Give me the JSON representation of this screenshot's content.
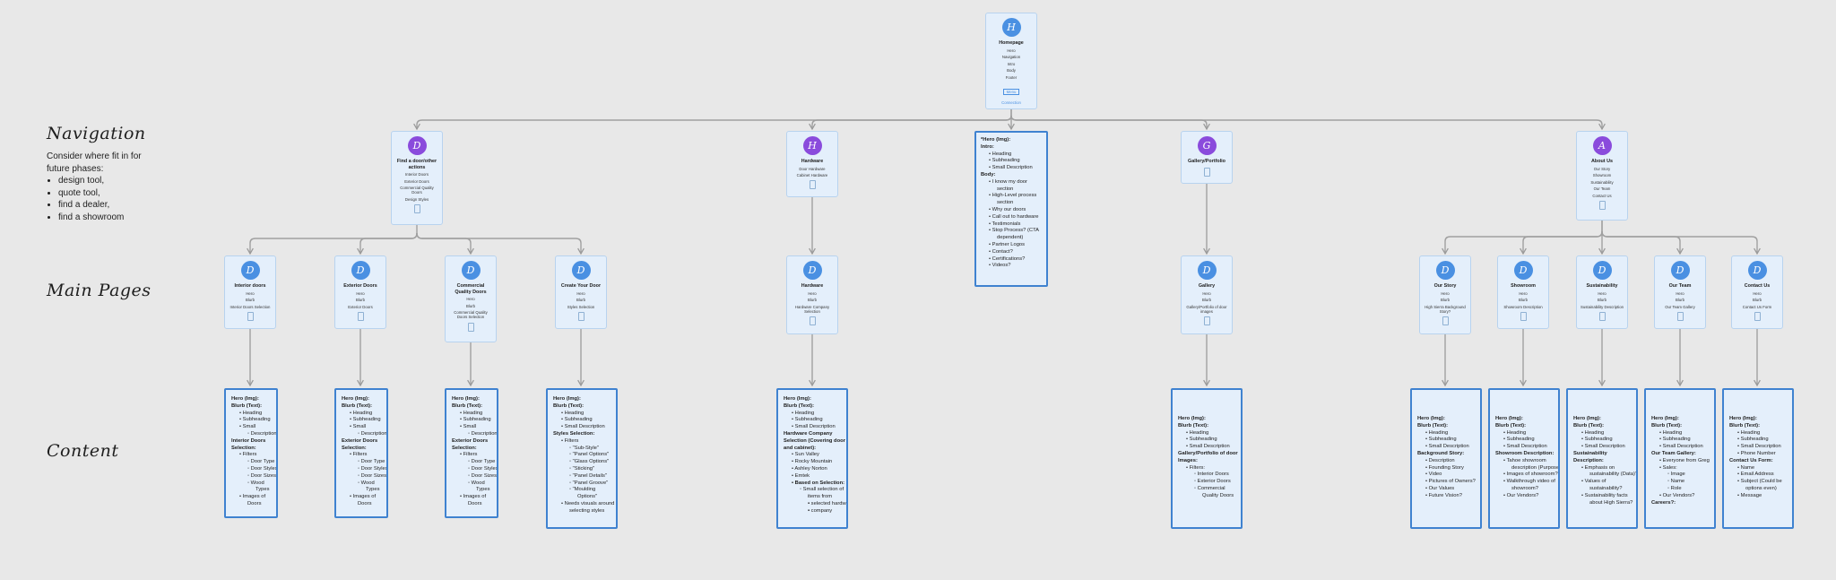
{
  "sections": {
    "navigation": "Navigation",
    "main_pages": "Main Pages",
    "content": "Content"
  },
  "nav_note": {
    "intro": "Consider where fit in for future phases:",
    "items": [
      "design tool,",
      "quote tool,",
      "find a dealer,",
      "find a showroom"
    ]
  },
  "cards": {
    "homepage": {
      "avatar": "H",
      "title": "Homepage",
      "items": [
        "Hero",
        "Navigation",
        "Intro",
        "Body",
        "Footer"
      ],
      "mini": "Menu",
      "link": "Connection"
    },
    "find_door": {
      "avatar": "D",
      "title": "Find a door/other actions",
      "items": [
        "Interior Doors",
        "Exterior Doors",
        "Commercial Quality Doors",
        "Design Styles"
      ]
    },
    "hardware_nav": {
      "avatar": "H",
      "title": "Hardware",
      "items": [
        "Door Hardware",
        "Cabinet Hardware"
      ]
    },
    "gallery_nav": {
      "avatar": "G",
      "title": "Gallery/Portfolio",
      "items": []
    },
    "about_nav": {
      "avatar": "A",
      "title": "About Us",
      "items": [
        "Our Story",
        "Showroom",
        "Sustainability",
        "Our Team",
        "Contact Us"
      ]
    },
    "interior": {
      "avatar": "D",
      "title": "Interior doors",
      "items": [
        "Hero",
        "Blurb",
        "Interior Doors Selection"
      ]
    },
    "exterior": {
      "avatar": "D",
      "title": "Exterior Doors",
      "items": [
        "Hero",
        "Blurb",
        "Exterior Doors"
      ]
    },
    "commercial": {
      "avatar": "D",
      "title": "Commercial Quality Doors",
      "items": [
        "Hero",
        "Blurb",
        "Commercial Quality Doors Selection"
      ]
    },
    "create_door": {
      "avatar": "D",
      "title": "Create Your Door",
      "items": [
        "Hero",
        "Blurb",
        "Styles Selection"
      ]
    },
    "hardware_main": {
      "avatar": "D",
      "title": "Hardware",
      "items": [
        "Hero",
        "Blurb",
        "Hardware Company Selection"
      ]
    },
    "gallery_main": {
      "avatar": "D",
      "title": "Gallery",
      "items": [
        "Hero",
        "Blurb",
        "Gallery/Portfolio of door images"
      ]
    },
    "our_story": {
      "avatar": "D",
      "title": "Our Story",
      "items": [
        "Hero",
        "Blurb",
        "High Sierra Background Story?"
      ]
    },
    "showroom": {
      "avatar": "D",
      "title": "Showroom",
      "items": [
        "Hero",
        "Blurb",
        "Showroom Description"
      ]
    },
    "sustainability": {
      "avatar": "D",
      "title": "Sustainability",
      "items": [
        "Hero",
        "Blurb",
        "Sustainability Description"
      ]
    },
    "our_team": {
      "avatar": "D",
      "title": "Our Team",
      "items": [
        "Hero",
        "Blurb",
        "Our Team Gallery"
      ]
    },
    "contact_us": {
      "avatar": "D",
      "title": "Contact Us",
      "items": [
        "Hero",
        "Blurb",
        "Contact Us Form"
      ]
    }
  },
  "content_boxes": {
    "home_content": [
      {
        "t": "*Hero (Img):",
        "b": true,
        "i": 0
      },
      {
        "t": "Intro:",
        "b": true,
        "i": 0
      },
      {
        "t": "Heading",
        "i": 1
      },
      {
        "t": "Subheading",
        "i": 1
      },
      {
        "t": "Small Description",
        "i": 1
      },
      {
        "t": "Body:",
        "b": true,
        "i": 0
      },
      {
        "t": "I know my door",
        "i": 1
      },
      {
        "t": "section",
        "i": 2
      },
      {
        "t": "High-Level process",
        "i": 1
      },
      {
        "t": "section",
        "i": 2
      },
      {
        "t": "Why our doors",
        "i": 1
      },
      {
        "t": "Call out to hardware",
        "i": 1
      },
      {
        "t": "Testimonials",
        "i": 1
      },
      {
        "t": "Stop Process? (CTA",
        "i": 1
      },
      {
        "t": "dependent)",
        "i": 2
      },
      {
        "t": "Partner Logos",
        "i": 1
      },
      {
        "t": "Contact?",
        "i": 1
      },
      {
        "t": "Certifications?",
        "i": 1
      },
      {
        "t": "Videos?",
        "i": 1
      }
    ],
    "interior_content": [
      {
        "t": "Hero (Img):",
        "b": true,
        "i": 0
      },
      {
        "t": "Blurb (Text):",
        "b": true,
        "i": 0
      },
      {
        "t": "Heading",
        "i": 1
      },
      {
        "t": "Subheading",
        "i": 1
      },
      {
        "t": "Small",
        "i": 1
      },
      {
        "t": "Description",
        "i": 2
      },
      {
        "t": "Interior Doors",
        "b": true,
        "i": 0
      },
      {
        "t": "Selection:",
        "b": true,
        "i": 0
      },
      {
        "t": "Filters",
        "i": 1
      },
      {
        "t": "Door Type",
        "i": 2
      },
      {
        "t": "Door Styles",
        "i": 2
      },
      {
        "t": "Door Sizes",
        "i": 2
      },
      {
        "t": "Wood",
        "i": 2
      },
      {
        "t": "Types",
        "i": 3
      },
      {
        "t": "Images of",
        "i": 1
      },
      {
        "t": "Doors",
        "i": 2
      }
    ],
    "exterior_content": [
      {
        "t": "Hero (Img):",
        "b": true,
        "i": 0
      },
      {
        "t": "Blurb (Text):",
        "b": true,
        "i": 0
      },
      {
        "t": "Heading",
        "i": 1
      },
      {
        "t": "Subheading",
        "i": 1
      },
      {
        "t": "Small",
        "i": 1
      },
      {
        "t": "Description",
        "i": 2
      },
      {
        "t": "Exterior Doors",
        "b": true,
        "i": 0
      },
      {
        "t": "Selection:",
        "b": true,
        "i": 0
      },
      {
        "t": "Filters",
        "i": 1
      },
      {
        "t": "Door Type",
        "i": 2
      },
      {
        "t": "Door Styles",
        "i": 2
      },
      {
        "t": "Door Sizes",
        "i": 2
      },
      {
        "t": "Wood",
        "i": 2
      },
      {
        "t": "Types",
        "i": 3
      },
      {
        "t": "Images of",
        "i": 1
      },
      {
        "t": "Doors",
        "i": 2
      }
    ],
    "commercial_content": [
      {
        "t": "Hero (Img):",
        "b": true,
        "i": 0
      },
      {
        "t": "Blurb (Text):",
        "b": true,
        "i": 0
      },
      {
        "t": "Heading",
        "i": 1
      },
      {
        "t": "Subheading",
        "i": 1
      },
      {
        "t": "Small",
        "i": 1
      },
      {
        "t": "Description",
        "i": 2
      },
      {
        "t": "Exterior Doors",
        "b": true,
        "i": 0
      },
      {
        "t": "Selection:",
        "b": true,
        "i": 0
      },
      {
        "t": "Filters",
        "i": 1
      },
      {
        "t": "Door Type",
        "i": 2
      },
      {
        "t": "Door Styles",
        "i": 2
      },
      {
        "t": "Door Sizes",
        "i": 2
      },
      {
        "t": "Wood",
        "i": 2
      },
      {
        "t": "Types",
        "i": 3
      },
      {
        "t": "Images of",
        "i": 1
      },
      {
        "t": "Doors",
        "i": 2
      }
    ],
    "create_content": [
      {
        "t": "Hero (Img):",
        "b": true,
        "i": 0
      },
      {
        "t": "Blurb (Text):",
        "b": true,
        "i": 0
      },
      {
        "t": "Heading",
        "i": 1
      },
      {
        "t": "Subheading",
        "i": 1
      },
      {
        "t": "Small Description",
        "i": 1
      },
      {
        "t": "Styles Selection:",
        "b": true,
        "i": 0
      },
      {
        "t": "Filters",
        "i": 1
      },
      {
        "t": "\"Sub-Style\"",
        "i": 2
      },
      {
        "t": "\"Panel Options\"",
        "i": 2
      },
      {
        "t": "\"Glass Options\"",
        "i": 2
      },
      {
        "t": "\"Sticking\"",
        "i": 2
      },
      {
        "t": "\"Panel Details\"",
        "i": 2
      },
      {
        "t": "\"Panel Groove\"",
        "i": 2
      },
      {
        "t": "\"Moulding",
        "i": 2
      },
      {
        "t": "Options\"",
        "i": 3
      },
      {
        "t": "Needs visuals around",
        "i": 1
      },
      {
        "t": "selecting styles",
        "i": 2
      }
    ],
    "hardware_content": [
      {
        "t": "Hero (Img):",
        "b": true,
        "i": 0
      },
      {
        "t": "Blurb (Text):",
        "b": true,
        "i": 0
      },
      {
        "t": "Heading",
        "i": 1
      },
      {
        "t": "Subheading",
        "i": 1
      },
      {
        "t": "Small Description",
        "i": 1
      },
      {
        "t": "Hardware Company",
        "b": true,
        "i": 0
      },
      {
        "t": "Selection (Covering door",
        "b": true,
        "i": 0
      },
      {
        "t": "and cabinet):",
        "b": true,
        "i": 0
      },
      {
        "t": "Sun Valley",
        "i": 1
      },
      {
        "t": "Rocky Mountain",
        "i": 1
      },
      {
        "t": "Ashley Norton",
        "i": 1
      },
      {
        "t": "Emtek",
        "i": 1
      },
      {
        "t": "Based on Selection:",
        "b": true,
        "i": 1
      },
      {
        "t": "Small selection of",
        "i": 2
      },
      {
        "t": "items from",
        "i": 3
      },
      {
        "t": "selected hardware",
        "i": 3
      },
      {
        "t": "company",
        "i": 3
      }
    ],
    "gallery_content": [
      {
        "t": "Hero (Img):",
        "b": true,
        "i": 0
      },
      {
        "t": "Blurb (Text):",
        "b": true,
        "i": 0
      },
      {
        "t": "Heading",
        "i": 1
      },
      {
        "t": "Subheading",
        "i": 1
      },
      {
        "t": "Small Description",
        "i": 1
      },
      {
        "t": "Gallery/Portfolio of door",
        "b": true,
        "i": 0
      },
      {
        "t": "Images:",
        "b": true,
        "i": 0
      },
      {
        "t": "Filters:",
        "i": 1
      },
      {
        "t": "Interior Doors",
        "i": 2
      },
      {
        "t": "Exterior Doors",
        "i": 2
      },
      {
        "t": "Commercial",
        "i": 2
      },
      {
        "t": "Quality Doors",
        "i": 3
      }
    ],
    "story_content": [
      {
        "t": "Hero (Img):",
        "b": true,
        "i": 0
      },
      {
        "t": "Blurb (Text):",
        "b": true,
        "i": 0
      },
      {
        "t": "Heading",
        "i": 1
      },
      {
        "t": "Subheading",
        "i": 1
      },
      {
        "t": "Small Description",
        "i": 1
      },
      {
        "t": "Background Story:",
        "b": true,
        "i": 0
      },
      {
        "t": "Description",
        "i": 1
      },
      {
        "t": "Founding Story",
        "i": 1
      },
      {
        "t": "Video",
        "i": 1
      },
      {
        "t": "Pictures of Owners?",
        "i": 1
      },
      {
        "t": "Our Values",
        "i": 1
      },
      {
        "t": "Future Vision?",
        "i": 1
      }
    ],
    "showroom_content": [
      {
        "t": "Hero (Img):",
        "b": true,
        "i": 0
      },
      {
        "t": "Blurb (Text):",
        "b": true,
        "i": 0
      },
      {
        "t": "Heading",
        "i": 1
      },
      {
        "t": "Subheading",
        "i": 1
      },
      {
        "t": "Small Description",
        "i": 1
      },
      {
        "t": "Showroom Description:",
        "b": true,
        "i": 0
      },
      {
        "t": "Tahoe showroom",
        "i": 1
      },
      {
        "t": "description (Purpose)",
        "i": 2
      },
      {
        "t": "Images of showroom?",
        "i": 1
      },
      {
        "t": "Walkthrough video of",
        "i": 1
      },
      {
        "t": "showroom?",
        "i": 2
      },
      {
        "t": "Our Vendors?",
        "i": 1
      }
    ],
    "sustain_content": [
      {
        "t": "Hero (Img):",
        "b": true,
        "i": 0
      },
      {
        "t": "Blurb (Text):",
        "b": true,
        "i": 0
      },
      {
        "t": "Heading",
        "i": 1
      },
      {
        "t": "Subheading",
        "i": 1
      },
      {
        "t": "Small Description",
        "i": 1
      },
      {
        "t": "Sustainability",
        "b": true,
        "i": 0
      },
      {
        "t": "Description:",
        "b": true,
        "i": 0
      },
      {
        "t": "Emphasis on",
        "i": 1
      },
      {
        "t": "sustainability (Data)?",
        "i": 2
      },
      {
        "t": "Values of",
        "i": 1
      },
      {
        "t": "sustainability?",
        "i": 2
      },
      {
        "t": "Sustainability facts",
        "i": 1
      },
      {
        "t": "about High Sierra?",
        "i": 2
      }
    ],
    "team_content": [
      {
        "t": "Hero (Img):",
        "b": true,
        "i": 0
      },
      {
        "t": "Blurb (Text):",
        "b": true,
        "i": 0
      },
      {
        "t": "Heading",
        "i": 1
      },
      {
        "t": "Subheading",
        "i": 1
      },
      {
        "t": "Small Description",
        "i": 1
      },
      {
        "t": "Our Team Gallery:",
        "b": true,
        "i": 0
      },
      {
        "t": "Everyone from Greg",
        "i": 1
      },
      {
        "t": "Sales:",
        "i": 1
      },
      {
        "t": "Image",
        "i": 2
      },
      {
        "t": "Name",
        "i": 2
      },
      {
        "t": "Role",
        "i": 2
      },
      {
        "t": "Our Vendors?",
        "i": 1
      },
      {
        "t": "Careers?:",
        "b": true,
        "i": 0
      }
    ],
    "contact_content": [
      {
        "t": "Hero (Img):",
        "b": true,
        "i": 0
      },
      {
        "t": "Blurb (Text):",
        "b": true,
        "i": 0
      },
      {
        "t": "Heading",
        "i": 1
      },
      {
        "t": "Subheading",
        "i": 1
      },
      {
        "t": "Small Description",
        "i": 1
      },
      {
        "t": "Phone Number",
        "i": 1
      },
      {
        "t": "Contact Us Form:",
        "b": true,
        "i": 0
      },
      {
        "t": "Name",
        "i": 1
      },
      {
        "t": "Email Address",
        "i": 1
      },
      {
        "t": "Subject (Could be",
        "i": 1
      },
      {
        "t": "options even)",
        "i": 2
      },
      {
        "t": "Message",
        "i": 1
      }
    ]
  },
  "colors": {
    "background": "#e8e8e8",
    "card_fill": "#e4effb",
    "content_border": "#3f82d0",
    "avatar_blue": "#4a90e2",
    "avatar_purple": "#8a4bdc",
    "connector": "#9a9a9a"
  }
}
